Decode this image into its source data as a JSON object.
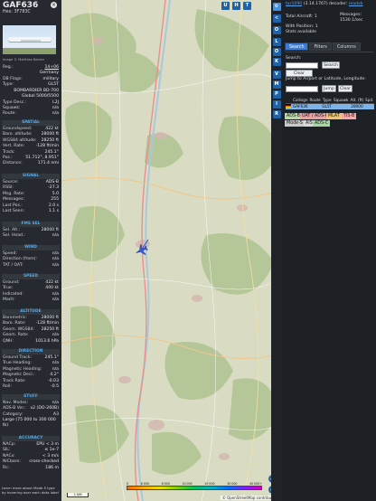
{
  "aircraft": {
    "callsign": "GAF636",
    "hex": "Hex: 3F783C",
    "image_credit": "Image © Matthias Becker",
    "reg_label": "Reg.:",
    "reg": "14+06",
    "country_label": "",
    "country": "Germany",
    "db_flags_label": "DB Flags:",
    "db_flags": "military",
    "type_label": "Type:",
    "type": "GL5T",
    "type_full": "BOMBARDIER BD-700 Global 5000/5500",
    "type_desc_label": "Type Desc.:",
    "type_desc": "L2J",
    "squawk_label": "Squawk:",
    "squawk": "n/a",
    "route_label": "Route:",
    "route": "n/a"
  },
  "sections": {
    "spatial": {
      "title": "SPATIAL",
      "rows": [
        {
          "k": "Groundspeed:",
          "v": "422 kt"
        },
        {
          "k": "Baro. altitude:",
          "v": "28000 ft"
        },
        {
          "k": "WGS84 altitude:",
          "v": "28250 ft"
        },
        {
          "k": "Vert. Rate:",
          "v": "-128 ft/min"
        },
        {
          "k": "Track:",
          "v": "245.1°"
        },
        {
          "k": "Pos.:",
          "v": "51.712°, 8.951°"
        },
        {
          "k": "Distance:",
          "v": "171.4 nmi"
        }
      ]
    },
    "signal": {
      "title": "SIGNAL",
      "rows": [
        {
          "k": "Source:",
          "v": "ADS-B"
        },
        {
          "k": "RSSI:",
          "v": "-27.3"
        },
        {
          "k": "Msg. Rate:",
          "v": "5.0"
        },
        {
          "k": "Messages:",
          "v": "255"
        },
        {
          "k": "Last Pos.:",
          "v": "2.0 s"
        },
        {
          "k": "Last Seen:",
          "v": "1.1 s"
        }
      ]
    },
    "fms": {
      "title": "FMS SEL",
      "rows": [
        {
          "k": "Sel. Alt.:",
          "v": "28000 ft"
        },
        {
          "k": "Sel. Head.:",
          "v": "n/a"
        }
      ]
    },
    "wind": {
      "title": "WIND",
      "rows": [
        {
          "k": "Speed:",
          "v": "n/a"
        },
        {
          "k": "Direction (from):",
          "v": "n/a"
        },
        {
          "k": "TAT / OAT:",
          "v": "n/a"
        }
      ]
    },
    "speed": {
      "title": "SPEED",
      "rows": [
        {
          "k": "Ground:",
          "v": "422 kt"
        },
        {
          "k": "True:",
          "v": "400 kt"
        },
        {
          "k": "Indicated:",
          "v": "n/a"
        },
        {
          "k": "Mach:",
          "v": "n/a"
        }
      ]
    },
    "altitude": {
      "title": "ALTITUDE",
      "rows": [
        {
          "k": "Barometric:",
          "v": "28000 ft"
        },
        {
          "k": "Baro. Rate:",
          "v": "-128 ft/min"
        },
        {
          "k": "Geom. WGS84:",
          "v": "28250 ft"
        },
        {
          "k": "Geom. Rate:",
          "v": "n/a"
        },
        {
          "k": "QNH:",
          "v": "1013.6 hPa"
        }
      ]
    },
    "direction": {
      "title": "DIRECTION",
      "rows": [
        {
          "k": "Ground Track:",
          "v": "245.1°"
        },
        {
          "k": "True Heading:",
          "v": "n/a"
        },
        {
          "k": "Magnetic Heading:",
          "v": "n/a"
        },
        {
          "k": "Magnetic Decl.:",
          "v": "4.2°"
        },
        {
          "k": "Track Rate:",
          "v": "-0.03"
        },
        {
          "k": "Roll:",
          "v": "-0.5"
        }
      ]
    },
    "stuff": {
      "title": "STUFF",
      "rows": [
        {
          "k": "Nav. Modes:",
          "v": "n/a"
        },
        {
          "k": "ADS-B Ver.:",
          "v": "v2 (DO-260B)"
        },
        {
          "k": "Category:",
          "v": "A3"
        }
      ],
      "category_desc": "Large (75 000 to 300 000 lb)"
    },
    "accuracy": {
      "title": "ACCURACY",
      "rows": [
        {
          "k": "NACp:",
          "v": "EPU < 3 m"
        },
        {
          "k": "SIL:",
          "v": "≤ 1e-7"
        },
        {
          "k": "NACv:",
          "v": "< 3 m/s"
        },
        {
          "k": "NICbaro:",
          "v": "cross-checked"
        },
        {
          "k": "Rc:",
          "v": "186 m"
        }
      ]
    },
    "footer": "Learn more about Mode S type by hovering over each data label"
  },
  "map": {
    "buttons": [
      "U",
      "H",
      "T"
    ],
    "scale": "2 NM",
    "attribution": "© OpenStreetMap contributors",
    "zoom_in": "+",
    "zoom_out": "−",
    "legend_ticks": [
      "0",
      "6 000",
      "8 000",
      "10 000",
      "20 000",
      "30 000",
      "40 000+"
    ]
  },
  "rail": {
    "buttons": [
      "<",
      "O",
      "L",
      "O",
      "K",
      "V",
      "M",
      "P",
      "I",
      "R"
    ]
  },
  "panel": {
    "site_link": "tar1090",
    "version": "(3.14.1767)",
    "decoder_label": "decoder:",
    "decoder_link": "readsb",
    "total_label": "Total Aircraft:",
    "total": "1",
    "messages_label": "Messages:",
    "messages": "1530.1/sec",
    "positions_label": "With Position:",
    "positions": "1",
    "stats_label": "Stats available",
    "tabs": [
      "Search",
      "Filters",
      "Columns"
    ],
    "search_label": "Search:",
    "search_btn": "Search",
    "clear_btn": "Clear Search",
    "jump_label": "Jump to Airport or Latitude, Longitude:",
    "jump_btn": "Jump",
    "clear2_btn": "Clear",
    "columns": [
      "",
      "Callsign",
      "Route",
      "Type",
      "Squawk",
      "Alt. (ft)",
      "Spd."
    ],
    "row": [
      "",
      "GAF636",
      "",
      "GL5T",
      "",
      "28000",
      ""
    ],
    "tags": [
      "ADS-B",
      "UAT / ADS-R",
      "MLAT",
      "TIS-B",
      "Mode-S",
      "AIS",
      "ADS-C"
    ],
    "tag_colors": [
      "#b8d7a8",
      "#e9a0a0",
      "#f2c46a",
      "#f7a6a6",
      "#c9c9c9",
      "#d8d8d8",
      "#a7d6a5"
    ]
  }
}
